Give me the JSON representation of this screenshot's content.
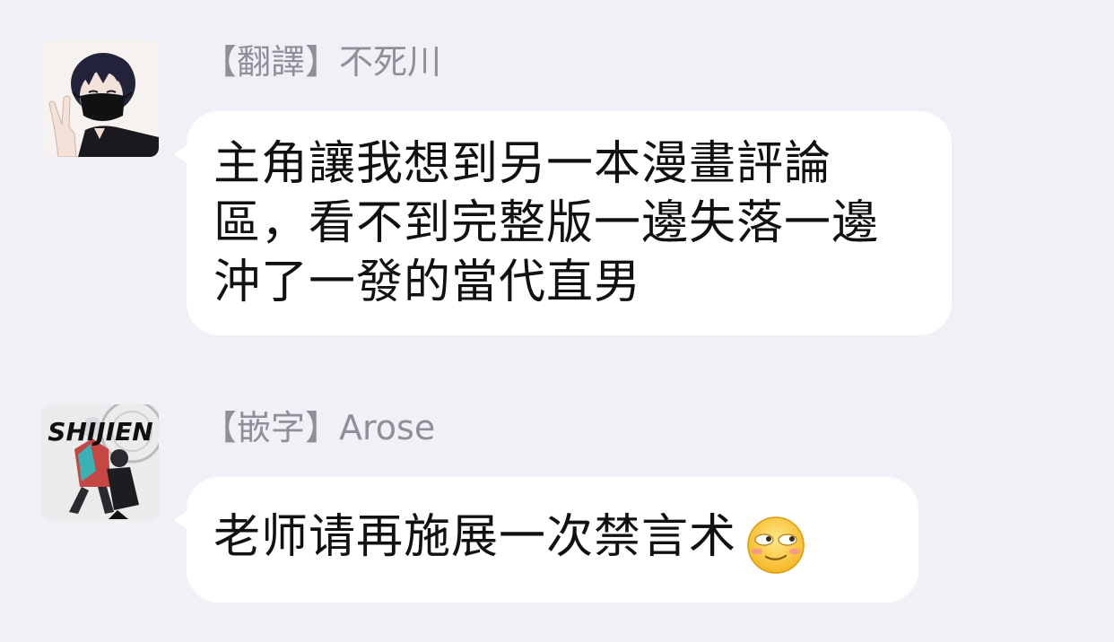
{
  "messages": [
    {
      "sender": "【翻譯】不死川",
      "avatar_icon": "user-avatar-icon",
      "text": "主角讓我想到另一本漫畫評論區，看不到完整版一邊失落一邊沖了一發的當代直男"
    },
    {
      "sender": "【嵌字】Arose",
      "avatar_icon": "manga-cover-avatar-icon",
      "avatar_cover_text": "SHIJIEN",
      "text": "老师请再施展一次禁言术",
      "emoji": "smirk-emoji-icon"
    }
  ],
  "colors": {
    "background": "#f0f0f7",
    "bubble": "#ffffff",
    "sender_text": "#8f8f99",
    "message_text": "#111111"
  }
}
